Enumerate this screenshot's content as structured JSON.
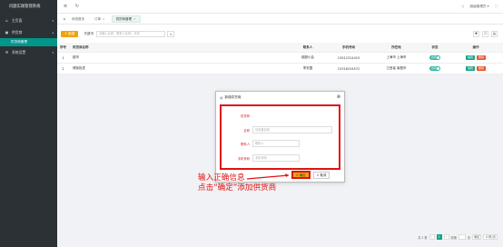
{
  "sidebar": {
    "brand": "问题实践管理系统",
    "items": [
      {
        "icon": "home-icon",
        "label": "主页面",
        "arrow": "▾"
      },
      {
        "icon": "folder-icon",
        "label": "供货商",
        "arrow": "▴"
      },
      {
        "icon": "gear-icon",
        "label": "系统设置",
        "arrow": "▾"
      }
    ],
    "active_sub": "供货商管理"
  },
  "topbar": {
    "user": "超级管理员",
    "user_arrow": "▾"
  },
  "tabs": [
    {
      "label": "系统首页",
      "active": false,
      "closable": false
    },
    {
      "label": "订单",
      "active": false,
      "closable": true
    },
    {
      "label": "供货商管理",
      "active": true,
      "closable": true
    }
  ],
  "toolbar": {
    "add_label": "+ 新增",
    "keyword_label": "关键词",
    "keyword_placeholder": "请输入名称、联系人名称、手机",
    "search_icon": "search-icon"
  },
  "table": {
    "headers": [
      "序号",
      "供货商名称",
      "联系人",
      "手机号码",
      "所在地",
      "状态",
      "操作"
    ],
    "rows": [
      {
        "no": "1",
        "name": "超市",
        "contact": "超超小会",
        "phone": "13012314415",
        "area": "上海市 上海市",
        "status": "启用",
        "edit": "编辑",
        "delete": "删除"
      },
      {
        "no": "2",
        "name": "博钟批发",
        "contact": "李安国",
        "phone": "15316234572",
        "area": "江西省 南昌市",
        "status": "启用",
        "edit": "编辑",
        "delete": "删除"
      }
    ]
  },
  "pager": {
    "total": "共 2 条",
    "prev": "‹",
    "current": "1",
    "next": "›",
    "goto_label": "到第",
    "page_unit": "页",
    "confirm": "确定",
    "size": "10条/页"
  },
  "dialog": {
    "title": "新增供货商",
    "fields": {
      "supplier_label": "供货商",
      "name_label": "名称",
      "name_placeholder": "请设置名称",
      "contact_label": "联系人",
      "contact_placeholder": "联系人",
      "phone_label": "手机号码",
      "phone_placeholder": "手机号码"
    },
    "ok_label": "确定",
    "cancel_label": "取消"
  },
  "annotation": {
    "line1": "输入正确信息",
    "line2": "点击“确定”添加供货商",
    "color": "#e01212"
  }
}
